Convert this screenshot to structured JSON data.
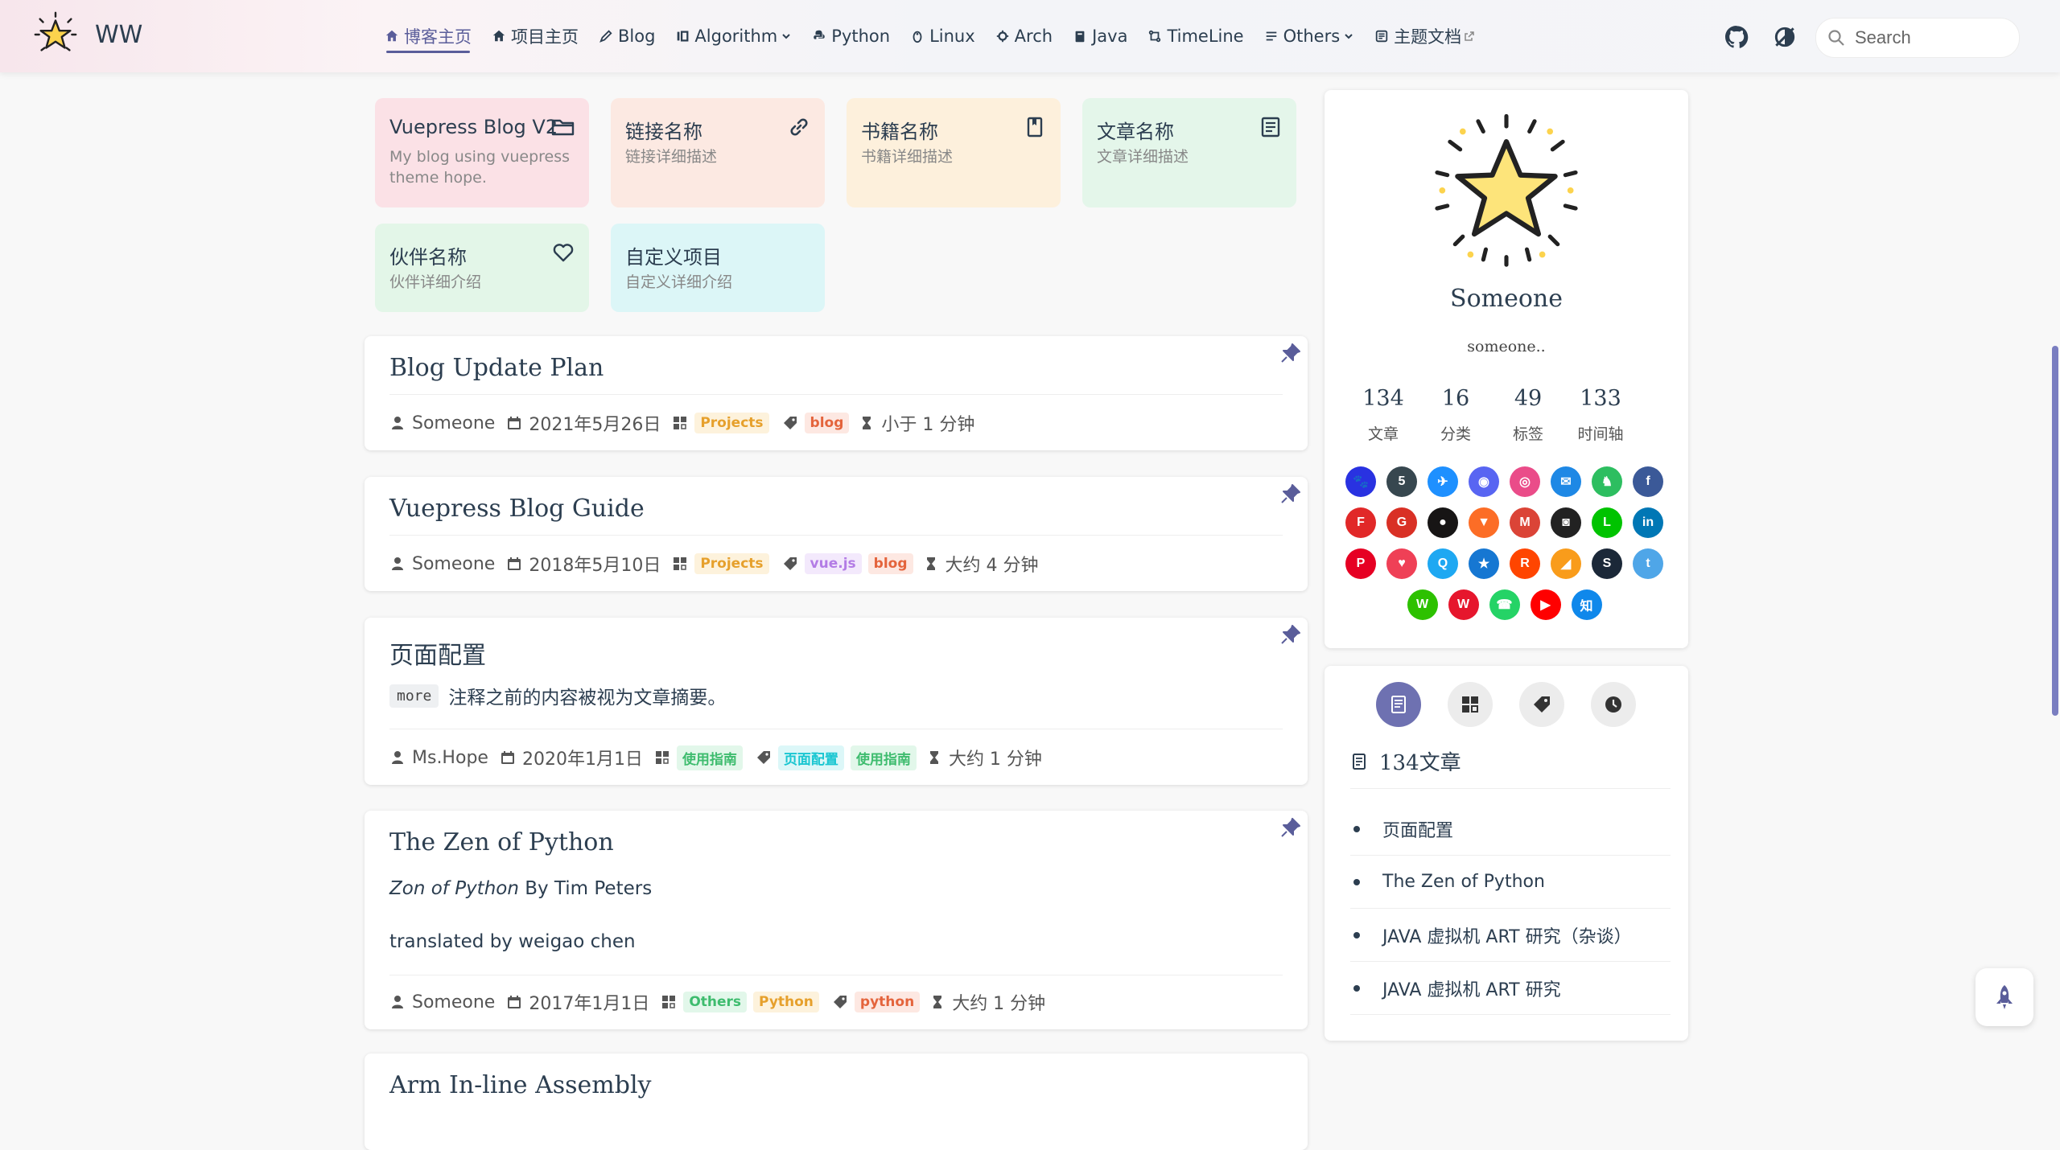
{
  "site": {
    "name": "WW"
  },
  "nav": {
    "items": [
      {
        "label": "博客主页",
        "icon": "home-icon",
        "active": true
      },
      {
        "label": "项目主页",
        "icon": "home-icon"
      },
      {
        "label": "Blog",
        "icon": "pen-icon"
      },
      {
        "label": "Algorithm",
        "icon": "algorithm-icon",
        "dropdown": true
      },
      {
        "label": "Python",
        "icon": "python-icon"
      },
      {
        "label": "Linux",
        "icon": "linux-icon"
      },
      {
        "label": "Arch",
        "icon": "arch-icon"
      },
      {
        "label": "Java",
        "icon": "java-icon"
      },
      {
        "label": "TimeLine",
        "icon": "timeline-icon"
      },
      {
        "label": "Others",
        "icon": "list-icon",
        "dropdown": true
      },
      {
        "label": "主题文档",
        "icon": "docs-icon",
        "external": true
      }
    ],
    "search_placeholder": "Search"
  },
  "projects": [
    {
      "title": "Vuepress Blog V2",
      "desc": "My blog using vuepress theme hope.",
      "icon": "folder-icon",
      "bg": "#fbe1e6"
    },
    {
      "title": "链接名称",
      "desc": "链接详细描述",
      "icon": "link-icon",
      "bg": "#fce9e2"
    },
    {
      "title": "书籍名称",
      "desc": "书籍详细描述",
      "icon": "book-icon",
      "bg": "#fdf0dc"
    },
    {
      "title": "文章名称",
      "desc": "文章详细描述",
      "icon": "article-icon",
      "bg": "#e4f6ea"
    },
    {
      "title": "伙伴名称",
      "desc": "伙伴详细介绍",
      "icon": "heart-icon",
      "bg": "#e3f6e8"
    },
    {
      "title": "自定义项目",
      "desc": "自定义详细介绍",
      "icon": "",
      "bg": "#dcf6f7"
    }
  ],
  "articles": [
    {
      "title": "Blog Update Plan",
      "author": "Someone",
      "date": "2021年5月26日",
      "categories": [
        "Projects"
      ],
      "tags": [
        "blog"
      ],
      "reading_time": "小于 1 分钟"
    },
    {
      "title": "Vuepress Blog Guide",
      "author": "Someone",
      "date": "2018年5月10日",
      "categories": [
        "Projects"
      ],
      "tags": [
        "vue.js",
        "blog"
      ],
      "reading_time": "大约 4 分钟"
    },
    {
      "title": "页面配置",
      "excerpt_code": "more",
      "excerpt_text": "注释之前的内容被视为文章摘要。",
      "author": "Ms.Hope",
      "date": "2020年1月1日",
      "categories": [
        "使用指南"
      ],
      "tags": [
        "页面配置",
        "使用指南"
      ],
      "reading_time": "大约 1 分钟"
    },
    {
      "title": "The Zen of Python",
      "excerpt_em": "Zon of Python",
      "excerpt_by": " By Tim Peters",
      "excerpt_line2": "translated by weigao chen",
      "author": "Someone",
      "date": "2017年1月1日",
      "categories": [
        "Others",
        "Python"
      ],
      "tags": [
        "python"
      ],
      "reading_time": "大约 1 分钟"
    },
    {
      "title": "Arm In-line Assembly"
    }
  ],
  "profile": {
    "name": "Someone",
    "description": "someone..",
    "stats": [
      {
        "value": "134",
        "label": "文章"
      },
      {
        "value": "16",
        "label": "分类"
      },
      {
        "value": "49",
        "label": "标签"
      },
      {
        "value": "133",
        "label": "时间轴"
      }
    ],
    "socials": [
      {
        "name": "baidu",
        "color": "#2932e1",
        "glyph": "🐾"
      },
      {
        "name": "bitbucket-html5",
        "color": "#37474f",
        "glyph": "5"
      },
      {
        "name": "bird",
        "color": "#1e90ff",
        "glyph": "✈"
      },
      {
        "name": "discord",
        "color": "#5865f2",
        "glyph": "◉"
      },
      {
        "name": "dribbble",
        "color": "#ea4c89",
        "glyph": "◎"
      },
      {
        "name": "email",
        "color": "#1e88e5",
        "glyph": "✉"
      },
      {
        "name": "evernote",
        "color": "#2dbe60",
        "glyph": "♞"
      },
      {
        "name": "facebook",
        "color": "#3b5998",
        "glyph": "f"
      },
      {
        "name": "flipboard",
        "color": "#e12828",
        "glyph": "F"
      },
      {
        "name": "gmail-g",
        "color": "#d93025",
        "glyph": "G"
      },
      {
        "name": "github",
        "color": "#171515",
        "glyph": "●"
      },
      {
        "name": "gitlab",
        "color": "#fc6d26",
        "glyph": "▼"
      },
      {
        "name": "gmail",
        "color": "#db4437",
        "glyph": "M"
      },
      {
        "name": "instagram",
        "color": "#222222",
        "glyph": "◙"
      },
      {
        "name": "line",
        "color": "#00c300",
        "glyph": "L"
      },
      {
        "name": "linkedin",
        "color": "#0077b5",
        "glyph": "in"
      },
      {
        "name": "pinterest",
        "color": "#e60023",
        "glyph": "P"
      },
      {
        "name": "pocket",
        "color": "#ef4056",
        "glyph": "♥"
      },
      {
        "name": "qq",
        "color": "#1ea8f2",
        "glyph": "Q"
      },
      {
        "name": "qzone",
        "color": "#1677d2",
        "glyph": "★"
      },
      {
        "name": "reddit",
        "color": "#ff4500",
        "glyph": "R"
      },
      {
        "name": "rss",
        "color": "#f99c1b",
        "glyph": "◢"
      },
      {
        "name": "steam",
        "color": "#1b2838",
        "glyph": "S"
      },
      {
        "name": "twitter",
        "color": "#4fa6e8",
        "glyph": "t"
      },
      {
        "name": "wechat",
        "color": "#2dc100",
        "glyph": "W"
      },
      {
        "name": "weibo",
        "color": "#e6162d",
        "glyph": "W"
      },
      {
        "name": "whatsapp",
        "color": "#25d366",
        "glyph": "☎"
      },
      {
        "name": "youtube",
        "color": "#ff0000",
        "glyph": "▶"
      },
      {
        "name": "zhihu",
        "color": "#0f88eb",
        "glyph": "知"
      }
    ]
  },
  "article_panel": {
    "count_label": "134文章",
    "items": [
      "页面配置",
      "The Zen of Python",
      "JAVA 虚拟机 ART 研究（杂谈）",
      "JAVA 虚拟机 ART 研究"
    ]
  }
}
